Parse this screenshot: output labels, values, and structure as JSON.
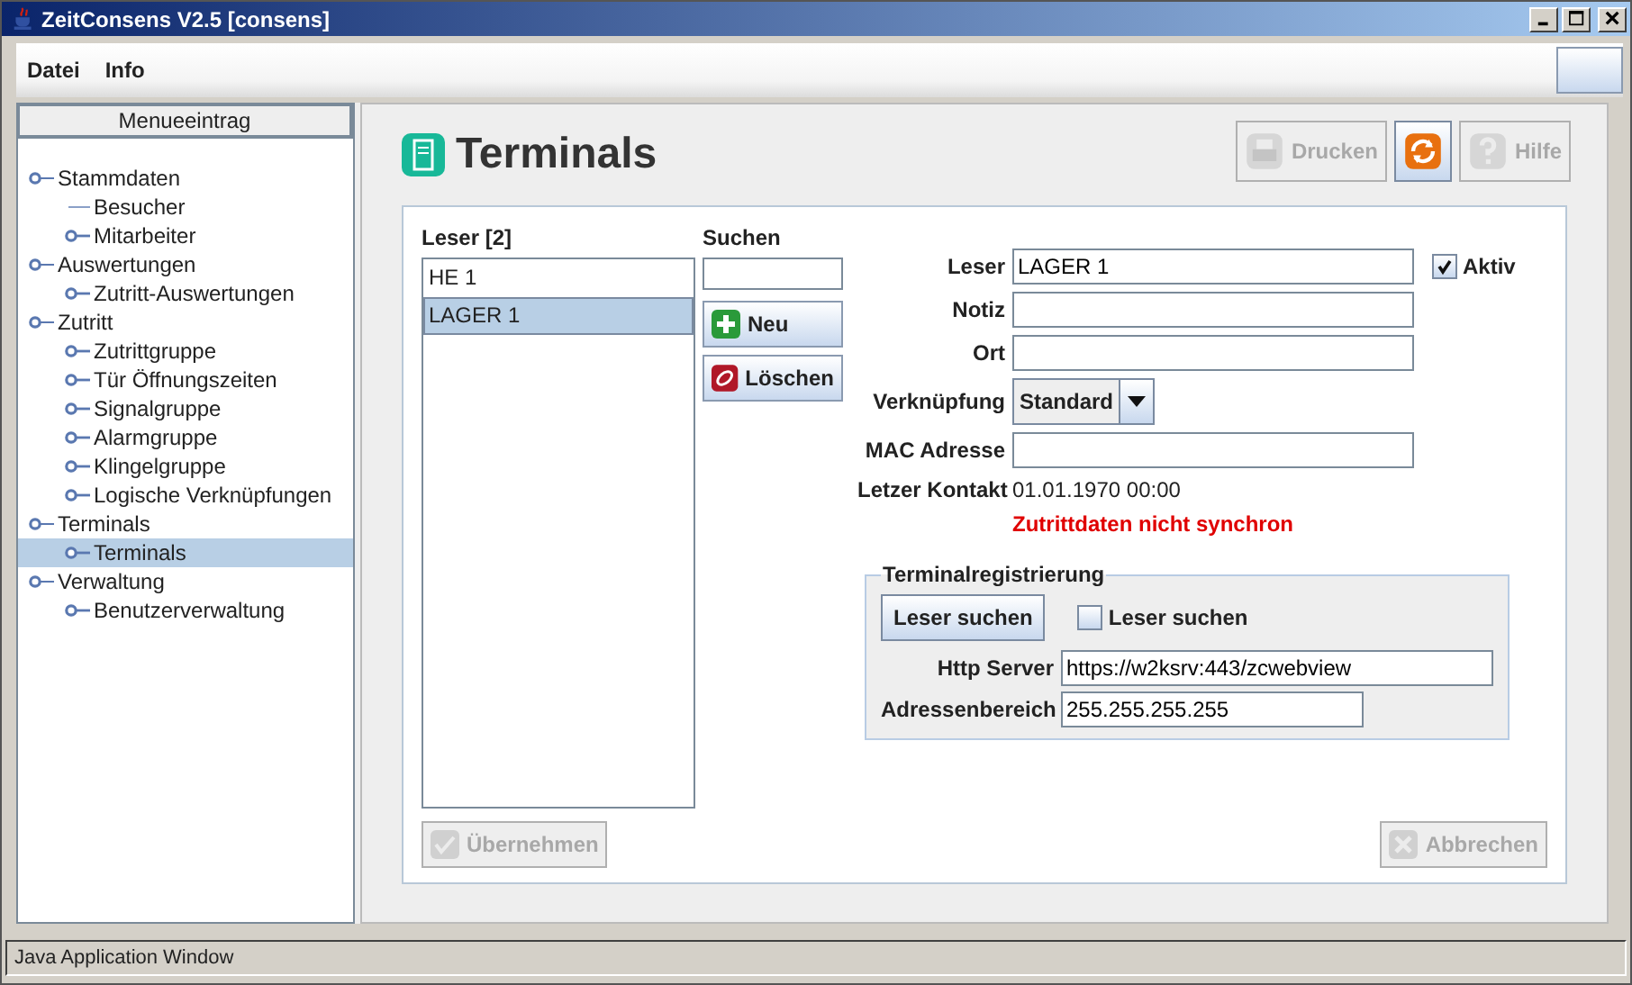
{
  "window": {
    "title": "ZeitConsens V2.5 [consens]"
  },
  "menu": [
    {
      "label": "Datei"
    },
    {
      "label": "Info"
    }
  ],
  "sidebar": {
    "header": "Menueeintrag",
    "items": [
      {
        "label": "Stammdaten",
        "selected": false,
        "children": [
          {
            "label": "Besucher",
            "kind": "plain",
            "selected": false
          },
          {
            "label": "Mitarbeiter",
            "kind": "node",
            "selected": false
          }
        ]
      },
      {
        "label": "Auswertungen",
        "selected": false,
        "children": [
          {
            "label": "Zutritt-Auswertungen",
            "kind": "node",
            "selected": false
          }
        ]
      },
      {
        "label": "Zutritt",
        "selected": false,
        "children": [
          {
            "label": "Zutrittgruppe",
            "kind": "node",
            "selected": false
          },
          {
            "label": "Tür Öffnungszeiten",
            "kind": "node",
            "selected": false
          },
          {
            "label": "Signalgruppe",
            "kind": "node",
            "selected": false
          },
          {
            "label": "Alarmgruppe",
            "kind": "node",
            "selected": false
          },
          {
            "label": "Klingelgruppe",
            "kind": "node",
            "selected": false
          },
          {
            "label": "Logische Verknüpfungen",
            "kind": "node",
            "selected": false
          }
        ]
      },
      {
        "label": "Terminals",
        "selected": false,
        "children": [
          {
            "label": "Terminals",
            "kind": "node",
            "selected": true
          }
        ]
      },
      {
        "label": "Verwaltung",
        "selected": false,
        "children": [
          {
            "label": "Benutzerverwaltung",
            "kind": "node",
            "selected": false
          }
        ]
      }
    ]
  },
  "page": {
    "title": "Terminals"
  },
  "toolbar": [
    {
      "label": "Drucken",
      "kind": "print",
      "disabled": true
    },
    {
      "kind": "refresh",
      "disabled": false
    },
    {
      "label": "Hilfe",
      "kind": "help",
      "disabled": true
    }
  ],
  "reader_list": {
    "label": "Leser  [2]",
    "items": [
      {
        "label": "HE 1",
        "selected": false
      },
      {
        "label": "LAGER 1",
        "selected": true
      }
    ]
  },
  "search": {
    "label": "Suchen"
  },
  "actions": [
    {
      "label": "Neu",
      "kind": "add"
    },
    {
      "label": "Löschen",
      "kind": "delete"
    }
  ],
  "form": {
    "rows": [
      {
        "kind": "text",
        "label": "Leser",
        "value": "LAGER 1",
        "checkbox": {
          "label": "Aktiv",
          "checked": true
        }
      },
      {
        "kind": "text",
        "label": "Notiz"
      },
      {
        "kind": "text",
        "label": "Ort"
      },
      {
        "kind": "select",
        "label": "Verknüpfung",
        "value": "Standard"
      },
      {
        "kind": "text",
        "label": "MAC Adresse"
      },
      {
        "kind": "info",
        "label": "Letzer Kontakt",
        "value": "01.01.1970 00:00"
      },
      {
        "kind": "warning",
        "value": "Zutrittdaten nicht synchron"
      }
    ]
  },
  "registration": {
    "title": "Terminalregistrierung",
    "button": "Leser suchen",
    "checkbox": {
      "label": "Leser suchen",
      "checked": false
    },
    "fields": [
      {
        "label": "Http Server",
        "value": "https://w2ksrv:443/zcwebview"
      },
      {
        "label": "Adressenbereich",
        "value": "255.255.255.255"
      }
    ]
  },
  "footer": [
    {
      "label": "Übernehmen",
      "kind": "apply",
      "disabled": true
    },
    {
      "label": "Abbrechen",
      "kind": "cancel",
      "disabled": true
    }
  ],
  "status_bar": "Java Application Window"
}
